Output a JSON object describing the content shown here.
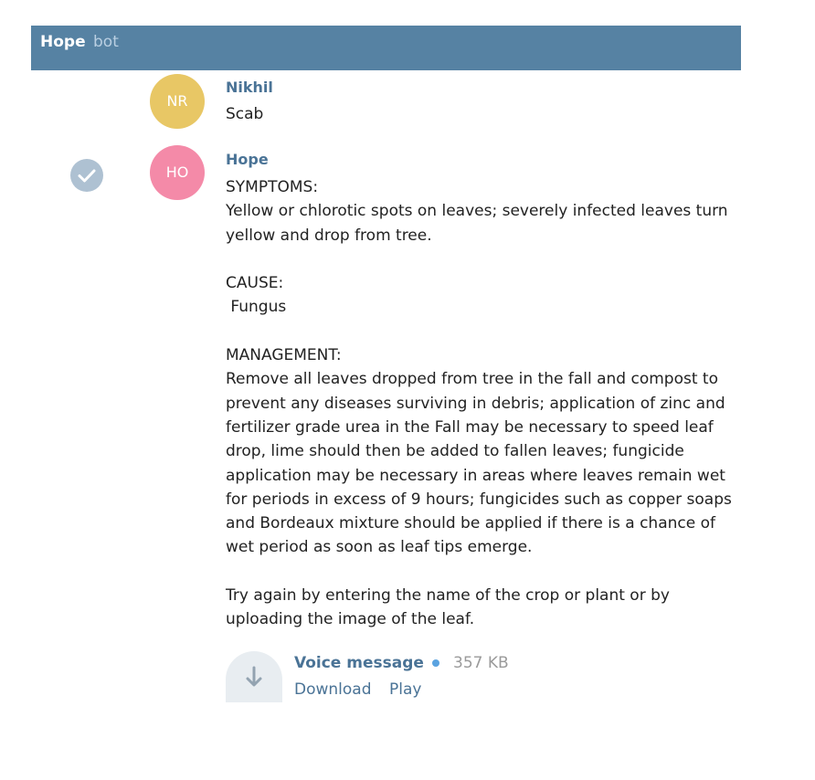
{
  "header": {
    "title": "Hope",
    "subtitle": "bot"
  },
  "messages": [
    {
      "initials": "NR",
      "author": "Nikhil",
      "text": "Scab",
      "avatar_color": "#e8c765"
    },
    {
      "initials": "HO",
      "author": "Hope",
      "text": "SYMPTOMS:\nYellow or chlorotic spots on leaves; severely infected leaves turn yellow and drop from tree.\n\nCAUSE:\n Fungus\n\nMANAGEMENT:\nRemove all leaves dropped from tree in the fall and compost to prevent any diseases surviving in debris; application of zinc and fertilizer grade urea in the Fall may be necessary to speed leaf drop, lime should then be added to fallen leaves; fungicide application may be necessary in areas where leaves remain wet for periods in excess of 9 hours; fungicides such as copper soaps and Bordeaux mixture should be applied if there is a chance of wet period as soon as leaf tips emerge.\n\nTry again by entering the name of the crop or plant or by uploading the image of the leaf.",
      "avatar_color": "#f48aa8",
      "status_icon": "check-icon"
    }
  ],
  "voice": {
    "title": "Voice message",
    "size": "357 KB",
    "download_label": "Download",
    "play_label": "Play",
    "icon": "download-arrow-icon"
  },
  "colors": {
    "header_bg": "#5682a3",
    "link": "#4a7396"
  }
}
